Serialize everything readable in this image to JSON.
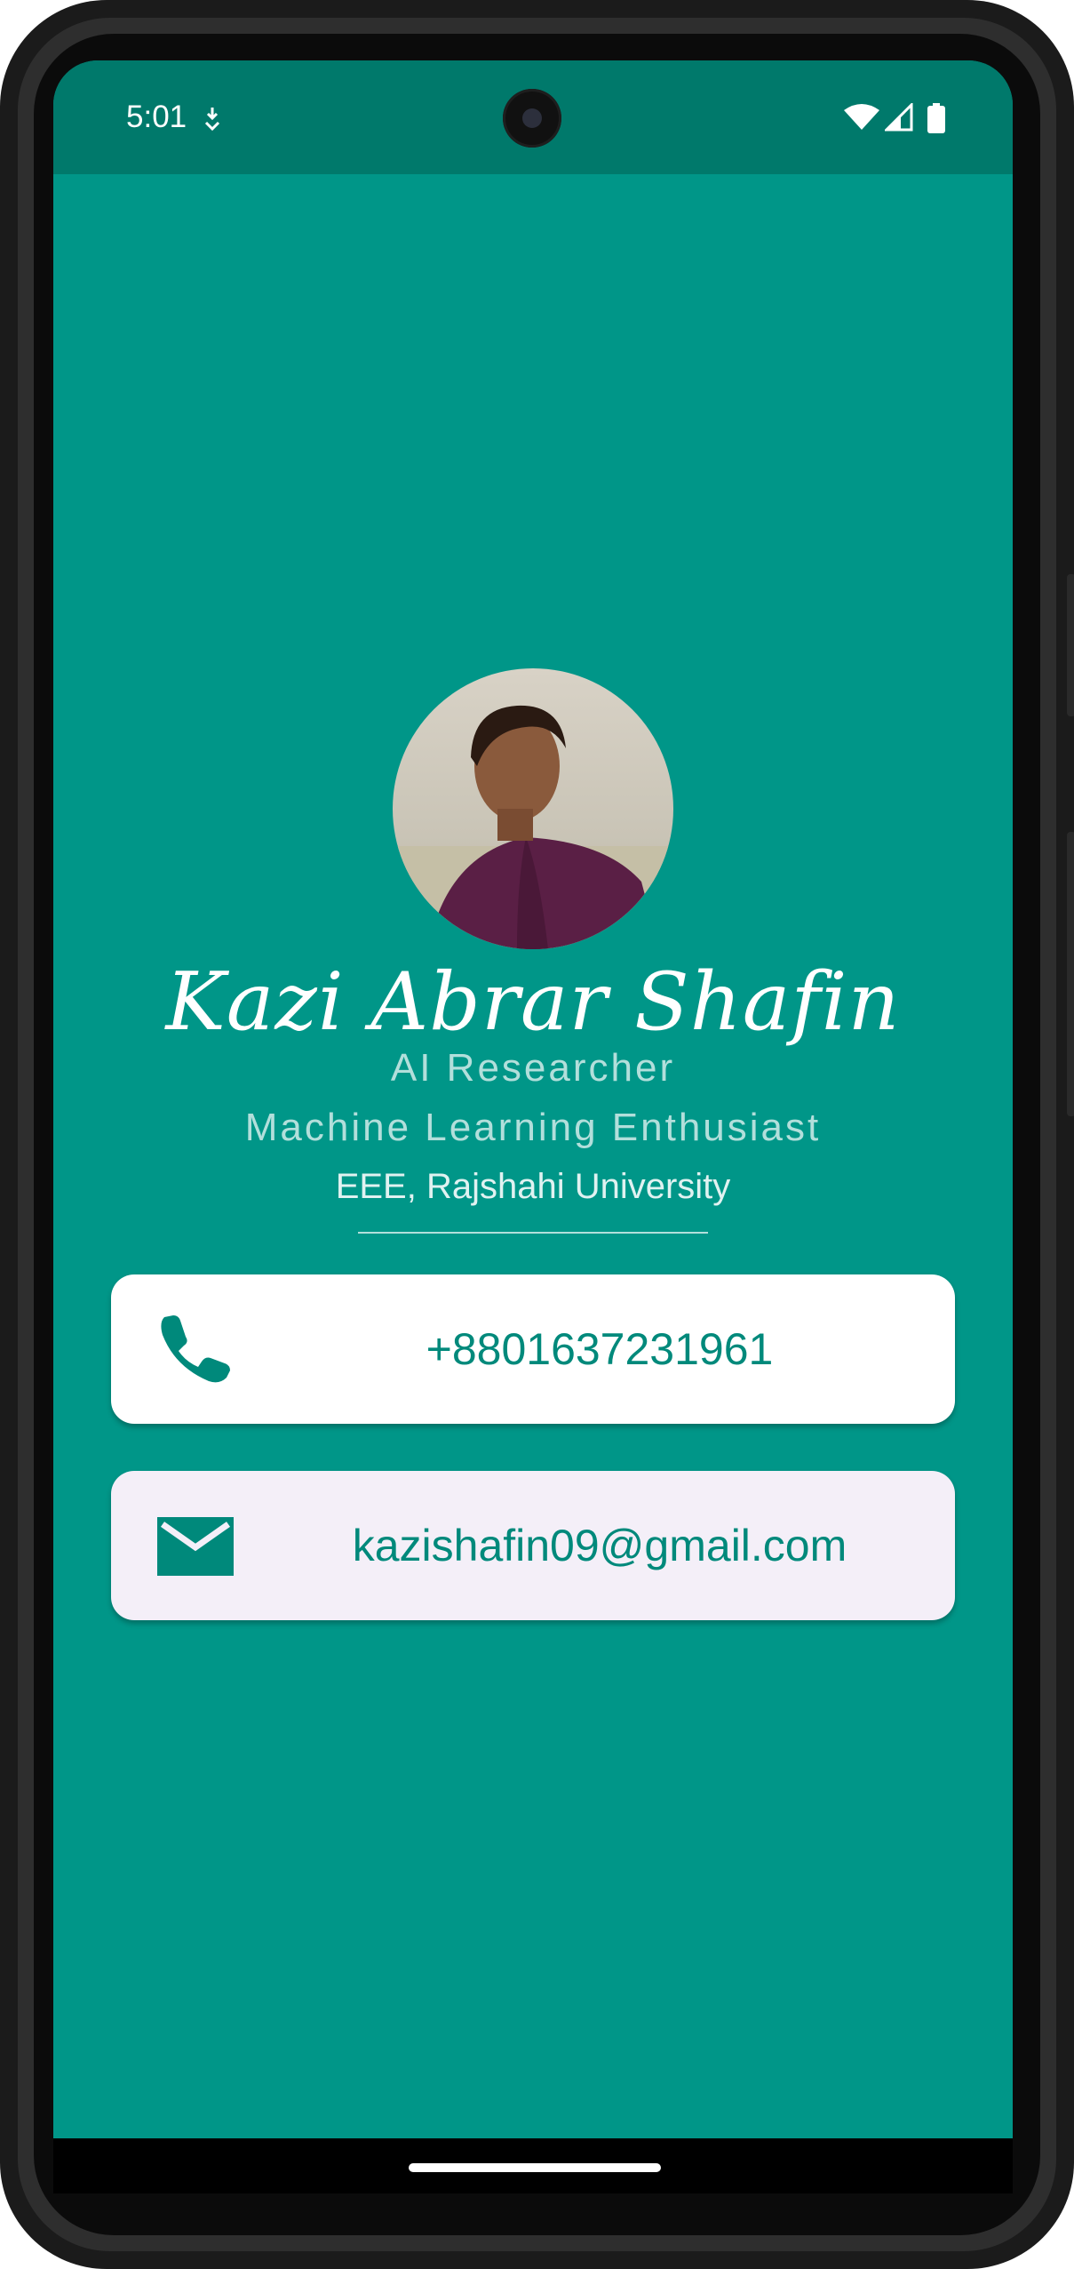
{
  "status_bar": {
    "time": "5:01"
  },
  "profile": {
    "name": "Kazi Abrar Shafin",
    "role_1": "AI Researcher",
    "role_2": "Machine Learning Enthusiast",
    "institution": "EEE, Rajshahi University"
  },
  "contacts": {
    "phone": "+8801637231961",
    "email": "kazishafin09@gmail.com"
  },
  "icons": {
    "phone": "phone-icon",
    "email": "email-icon",
    "wifi": "wifi-icon",
    "signal": "signal-icon",
    "battery": "battery-icon"
  },
  "colors": {
    "background": "#009688",
    "status_bar": "#00796b",
    "accent_text": "#00897b"
  }
}
